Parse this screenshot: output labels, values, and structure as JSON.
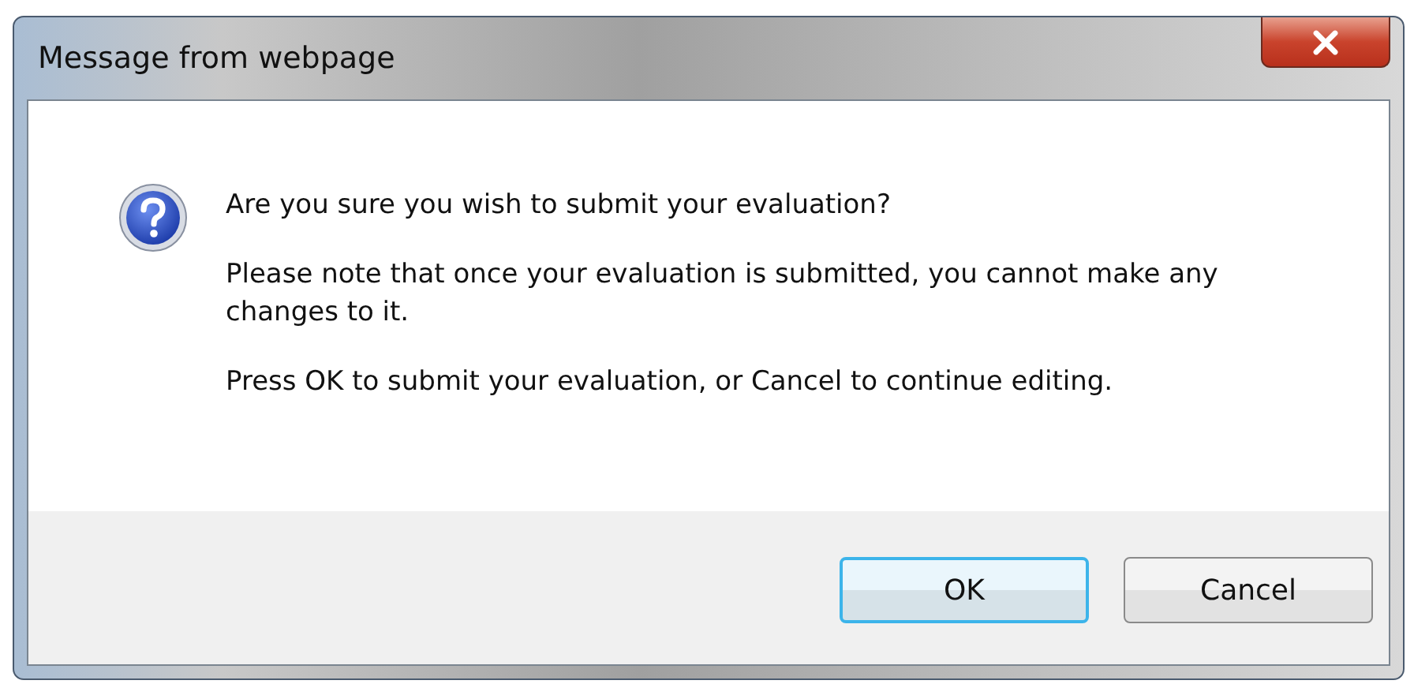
{
  "window": {
    "title": "Message from webpage"
  },
  "message": {
    "heading": "Are you sure you wish to submit your evaluation?",
    "paragraphs": [
      "Please note that once your evaluation is submitted, you cannot make any changes to it.",
      "Press OK to submit your evaluation, or Cancel to continue editing."
    ]
  },
  "buttons": [
    {
      "label": "OK",
      "default": true
    },
    {
      "label": "Cancel",
      "default": false
    }
  ]
}
